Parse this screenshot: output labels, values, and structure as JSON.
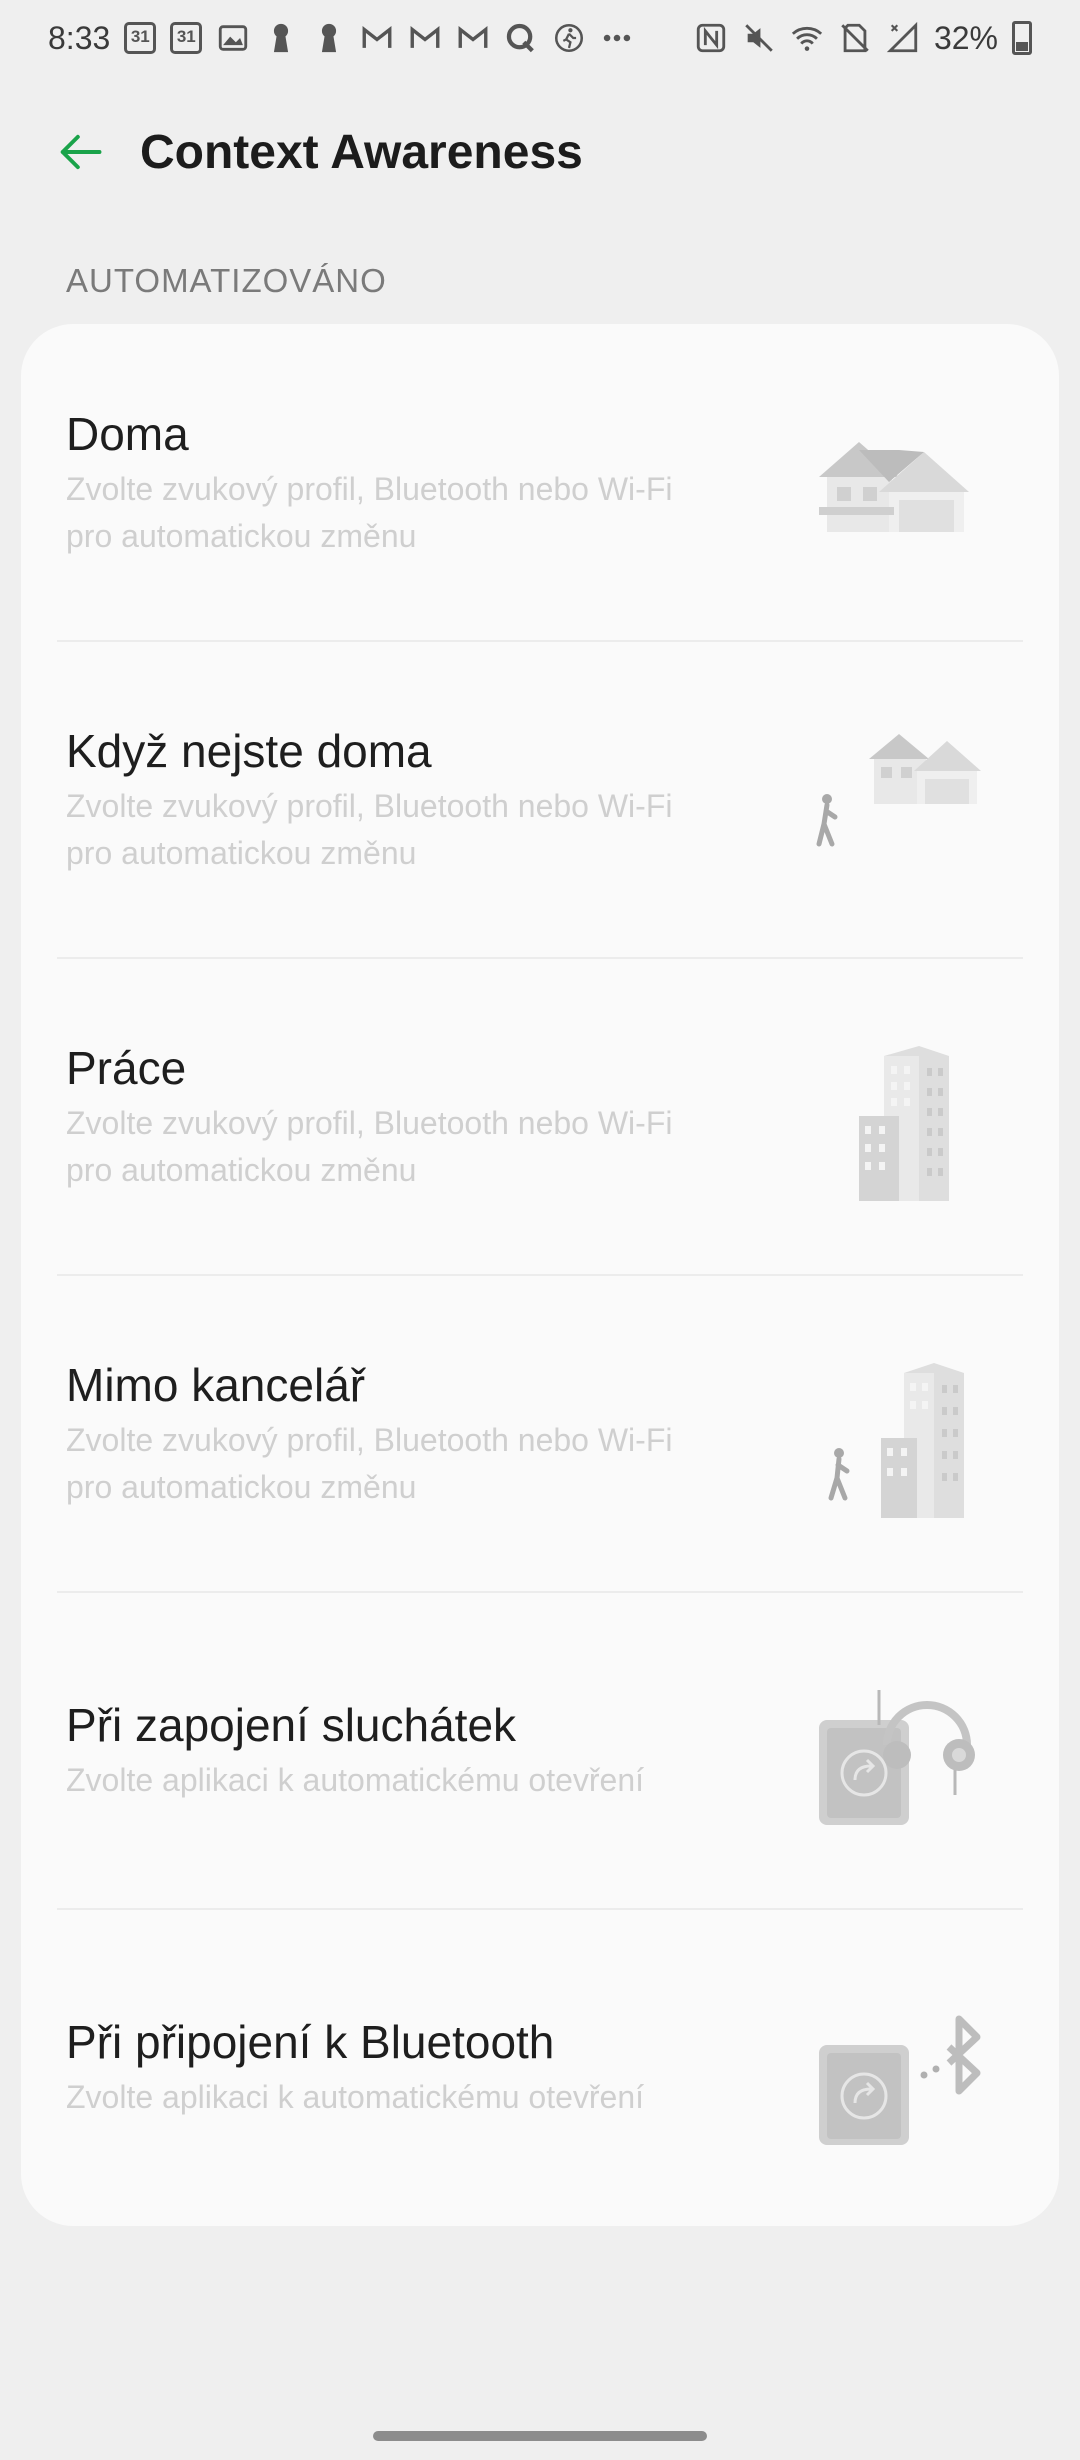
{
  "status_bar": {
    "time": "8:33",
    "calendar_day_1": "31",
    "calendar_day_2": "31",
    "battery_percent": "32%",
    "battery_level": 0.32,
    "icons_left": [
      "calendar-icon",
      "calendar-icon",
      "image-icon",
      "keyhole-icon",
      "keyhole-icon",
      "gmail-icon",
      "gmail-icon",
      "gmail-icon",
      "q-icon",
      "fitness-icon",
      "more-dots-icon"
    ],
    "icons_right": [
      "nfc-icon",
      "mute-icon",
      "wifi-icon",
      "no-sim-icon",
      "signal-icon",
      "battery-icon"
    ]
  },
  "app_bar": {
    "title": "Context Awareness",
    "accent_color": "#1aa34a"
  },
  "section": {
    "header": "AUTOMATIZOVÁNO"
  },
  "items": [
    {
      "title": "Doma",
      "desc_line1": "Zvolte zvukový profil, Bluetooth nebo Wi-Fi",
      "desc_line2": "pro automatickou změnu",
      "illustration": "house-illustration"
    },
    {
      "title": "Když nejste doma",
      "desc_line1": "Zvolte zvukový profil, Bluetooth nebo Wi-Fi",
      "desc_line2": "pro automatickou změnu",
      "illustration": "leaving-home-illustration"
    },
    {
      "title": "Práce",
      "desc_line1": "Zvolte zvukový profil, Bluetooth nebo Wi-Fi",
      "desc_line2": "pro automatickou změnu",
      "illustration": "office-building-illustration"
    },
    {
      "title": "Mimo kancelář",
      "desc_line1": "Zvolte zvukový profil, Bluetooth nebo Wi-Fi",
      "desc_line2": "pro automatickou změnu",
      "illustration": "leaving-office-illustration"
    },
    {
      "title": "Při zapojení sluchátek",
      "desc_line1": "Zvolte aplikaci k automatickému otevření",
      "illustration": "headphones-illustration"
    },
    {
      "title": "Při připojení k Bluetooth",
      "desc_line1": "Zvolte aplikaci k automatickému otevření",
      "illustration": "bluetooth-illustration"
    }
  ]
}
